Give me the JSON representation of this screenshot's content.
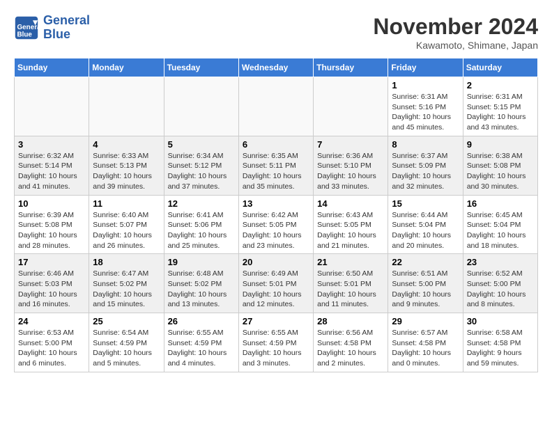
{
  "logo": {
    "line1": "General",
    "line2": "Blue"
  },
  "title": "November 2024",
  "location": "Kawamoto, Shimane, Japan",
  "weekdays": [
    "Sunday",
    "Monday",
    "Tuesday",
    "Wednesday",
    "Thursday",
    "Friday",
    "Saturday"
  ],
  "weeks": [
    [
      {
        "day": "",
        "info": ""
      },
      {
        "day": "",
        "info": ""
      },
      {
        "day": "",
        "info": ""
      },
      {
        "day": "",
        "info": ""
      },
      {
        "day": "",
        "info": ""
      },
      {
        "day": "1",
        "info": "Sunrise: 6:31 AM\nSunset: 5:16 PM\nDaylight: 10 hours\nand 45 minutes."
      },
      {
        "day": "2",
        "info": "Sunrise: 6:31 AM\nSunset: 5:15 PM\nDaylight: 10 hours\nand 43 minutes."
      }
    ],
    [
      {
        "day": "3",
        "info": "Sunrise: 6:32 AM\nSunset: 5:14 PM\nDaylight: 10 hours\nand 41 minutes."
      },
      {
        "day": "4",
        "info": "Sunrise: 6:33 AM\nSunset: 5:13 PM\nDaylight: 10 hours\nand 39 minutes."
      },
      {
        "day": "5",
        "info": "Sunrise: 6:34 AM\nSunset: 5:12 PM\nDaylight: 10 hours\nand 37 minutes."
      },
      {
        "day": "6",
        "info": "Sunrise: 6:35 AM\nSunset: 5:11 PM\nDaylight: 10 hours\nand 35 minutes."
      },
      {
        "day": "7",
        "info": "Sunrise: 6:36 AM\nSunset: 5:10 PM\nDaylight: 10 hours\nand 33 minutes."
      },
      {
        "day": "8",
        "info": "Sunrise: 6:37 AM\nSunset: 5:09 PM\nDaylight: 10 hours\nand 32 minutes."
      },
      {
        "day": "9",
        "info": "Sunrise: 6:38 AM\nSunset: 5:08 PM\nDaylight: 10 hours\nand 30 minutes."
      }
    ],
    [
      {
        "day": "10",
        "info": "Sunrise: 6:39 AM\nSunset: 5:08 PM\nDaylight: 10 hours\nand 28 minutes."
      },
      {
        "day": "11",
        "info": "Sunrise: 6:40 AM\nSunset: 5:07 PM\nDaylight: 10 hours\nand 26 minutes."
      },
      {
        "day": "12",
        "info": "Sunrise: 6:41 AM\nSunset: 5:06 PM\nDaylight: 10 hours\nand 25 minutes."
      },
      {
        "day": "13",
        "info": "Sunrise: 6:42 AM\nSunset: 5:05 PM\nDaylight: 10 hours\nand 23 minutes."
      },
      {
        "day": "14",
        "info": "Sunrise: 6:43 AM\nSunset: 5:05 PM\nDaylight: 10 hours\nand 21 minutes."
      },
      {
        "day": "15",
        "info": "Sunrise: 6:44 AM\nSunset: 5:04 PM\nDaylight: 10 hours\nand 20 minutes."
      },
      {
        "day": "16",
        "info": "Sunrise: 6:45 AM\nSunset: 5:04 PM\nDaylight: 10 hours\nand 18 minutes."
      }
    ],
    [
      {
        "day": "17",
        "info": "Sunrise: 6:46 AM\nSunset: 5:03 PM\nDaylight: 10 hours\nand 16 minutes."
      },
      {
        "day": "18",
        "info": "Sunrise: 6:47 AM\nSunset: 5:02 PM\nDaylight: 10 hours\nand 15 minutes."
      },
      {
        "day": "19",
        "info": "Sunrise: 6:48 AM\nSunset: 5:02 PM\nDaylight: 10 hours\nand 13 minutes."
      },
      {
        "day": "20",
        "info": "Sunrise: 6:49 AM\nSunset: 5:01 PM\nDaylight: 10 hours\nand 12 minutes."
      },
      {
        "day": "21",
        "info": "Sunrise: 6:50 AM\nSunset: 5:01 PM\nDaylight: 10 hours\nand 11 minutes."
      },
      {
        "day": "22",
        "info": "Sunrise: 6:51 AM\nSunset: 5:00 PM\nDaylight: 10 hours\nand 9 minutes."
      },
      {
        "day": "23",
        "info": "Sunrise: 6:52 AM\nSunset: 5:00 PM\nDaylight: 10 hours\nand 8 minutes."
      }
    ],
    [
      {
        "day": "24",
        "info": "Sunrise: 6:53 AM\nSunset: 5:00 PM\nDaylight: 10 hours\nand 6 minutes."
      },
      {
        "day": "25",
        "info": "Sunrise: 6:54 AM\nSunset: 4:59 PM\nDaylight: 10 hours\nand 5 minutes."
      },
      {
        "day": "26",
        "info": "Sunrise: 6:55 AM\nSunset: 4:59 PM\nDaylight: 10 hours\nand 4 minutes."
      },
      {
        "day": "27",
        "info": "Sunrise: 6:55 AM\nSunset: 4:59 PM\nDaylight: 10 hours\nand 3 minutes."
      },
      {
        "day": "28",
        "info": "Sunrise: 6:56 AM\nSunset: 4:58 PM\nDaylight: 10 hours\nand 2 minutes."
      },
      {
        "day": "29",
        "info": "Sunrise: 6:57 AM\nSunset: 4:58 PM\nDaylight: 10 hours\nand 0 minutes."
      },
      {
        "day": "30",
        "info": "Sunrise: 6:58 AM\nSunset: 4:58 PM\nDaylight: 9 hours\nand 59 minutes."
      }
    ]
  ]
}
